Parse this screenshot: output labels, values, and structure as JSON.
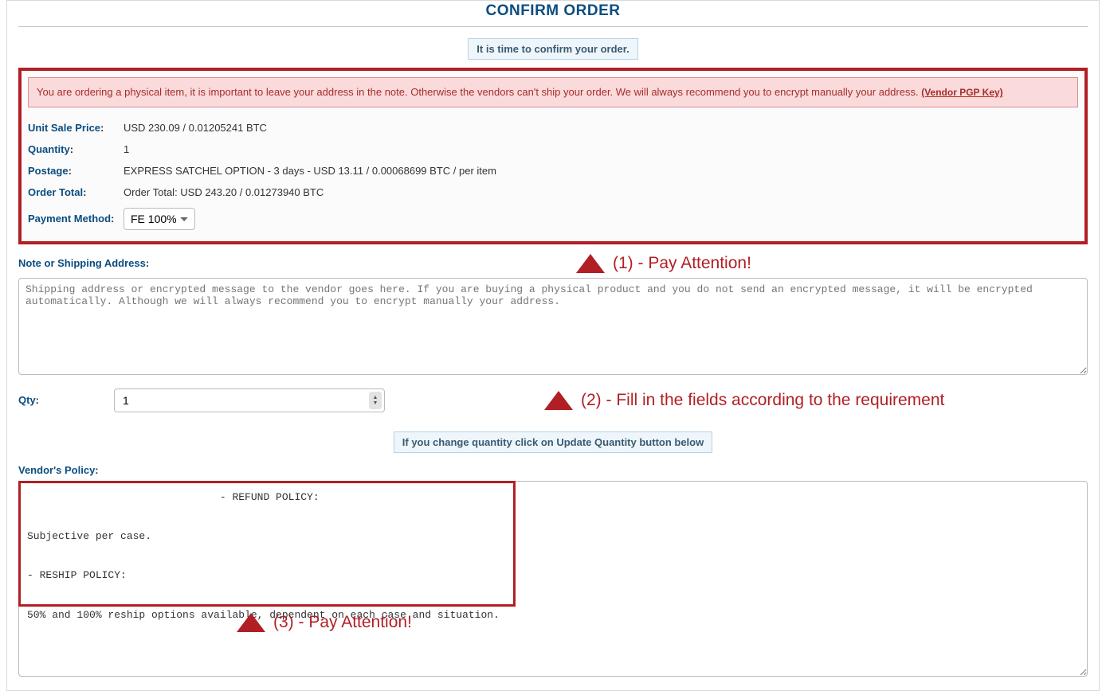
{
  "page": {
    "title": "CONFIRM ORDER",
    "subtitle_banner": "It is time to confirm your order."
  },
  "warning": {
    "text": "You are ordering a physical item, it is important to leave your address in the note. Otherwise the vendors can't ship your order. We will always recommend you to encrypt manually your address. ",
    "link_text": "(Vendor PGP Key)"
  },
  "order": {
    "unit_sale_price_label": "Unit Sale Price",
    "unit_sale_price_value": "USD 230.09 / 0.01205241 BTC",
    "quantity_label": "Quantity",
    "quantity_value": "1",
    "postage_label": "Postage",
    "postage_value": "EXPRESS SATCHEL OPTION - 3 days - USD 13.11 / 0.00068699 BTC / per item",
    "order_total_label": "Order Total",
    "order_total_value": "Order Total: USD 243.20 / 0.01273940 BTC",
    "payment_method_label": "Payment Method",
    "payment_method_selected": "FE 100%",
    "payment_method_options": [
      "FE 100%"
    ]
  },
  "note": {
    "label": "Note or Shipping Address",
    "placeholder": "Shipping address or encrypted message to the vendor goes here. If you are buying a physical product and you do not send an encrypted message, it will be encrypted automatically. Although we will always recommend you to encrypt manually your address."
  },
  "qty": {
    "label": "Qty",
    "value": "1"
  },
  "update_banner": "If you change quantity click on Update Quantity button below",
  "vendor_policy": {
    "label": "Vendor's Policy",
    "text": "                               - REFUND POLICY:\n\nSubjective per case.\n\n- RESHIP POLICY:\n\n50% and 100% reship options available, dependent on each case and situation."
  },
  "annotations": {
    "a1": "(1) - Pay Attention!",
    "a2": "(2) - Fill in the fields according to the requirement",
    "a3": "(3) - Pay Attention!"
  }
}
